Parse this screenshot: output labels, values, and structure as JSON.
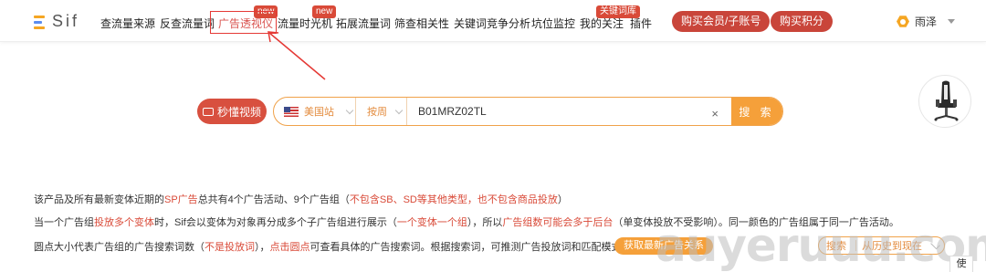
{
  "brand": {
    "name": "Sif"
  },
  "nav": {
    "items": [
      {
        "label": "查流量来源"
      },
      {
        "label": "反查流量词"
      },
      {
        "label": "广告透视仪",
        "badge": "new",
        "active": true
      },
      {
        "label": "流量时光机",
        "badge": "new"
      },
      {
        "label": "拓展流量词"
      },
      {
        "label": "筛查相关性"
      },
      {
        "label": "关键词竞争分析"
      },
      {
        "label": "坑位监控"
      },
      {
        "label": "我的关注",
        "badge": "关键词库"
      },
      {
        "label": "插件"
      }
    ],
    "buy_member": "购买会员/子账号",
    "buy_points": "购买积分"
  },
  "user": {
    "name": "雨泽",
    "icon": "user-hex-icon"
  },
  "search": {
    "video_button": "秒懂视频",
    "site": "美国站",
    "period": "按周",
    "query": "B01MRZ02TL",
    "clear": "×",
    "submit": "搜 索"
  },
  "info": {
    "line1": [
      {
        "t": "该产品及所有最新变体近期的"
      },
      {
        "t": "SP广告",
        "hl": true
      },
      {
        "t": "总共有4个广告活动、9个广告组（"
      },
      {
        "t": "不包含SB、SD等其他类型，也不包含商品投放",
        "hl": true
      },
      {
        "t": "）"
      }
    ],
    "line2": [
      {
        "t": "当一个广告组"
      },
      {
        "t": "投放多个变体",
        "hl": true
      },
      {
        "t": "时，Sif会以变体为对象再分成多个子广告组进行展示（"
      },
      {
        "t": "一个变体一个组",
        "hl": true
      },
      {
        "t": "），所以"
      },
      {
        "t": "广告组数可能会多于后台",
        "hl": true
      },
      {
        "t": "（单变体投放不受影响）。同一颜色的广告组属于同一广告活动。"
      }
    ],
    "line3": [
      {
        "t": "圆点大小代表广告组的广告搜索词数（"
      },
      {
        "t": "不是投放词",
        "hl": true
      },
      {
        "t": "），"
      },
      {
        "t": "点击圆点",
        "hl": true
      },
      {
        "t": "可查看具体的广告搜索词。根据搜索词，可推测广告投放词和匹配模式。"
      }
    ],
    "get_latest_button": "获取最新广告关系",
    "select_type": "搜索",
    "select_range": "从历史到现在"
  },
  "watermark": "auyeruuu.com",
  "side_tab": "使"
}
